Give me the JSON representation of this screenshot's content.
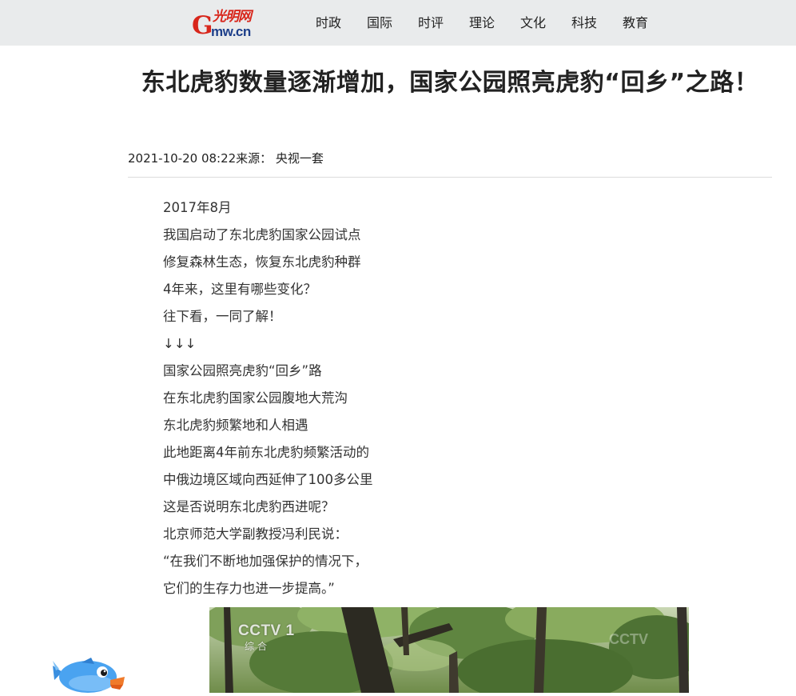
{
  "header": {
    "logo_cn": "光明网",
    "logo_g": "G",
    "logo_domain": "mw.cn",
    "nav": [
      "时政",
      "国际",
      "时评",
      "理论",
      "文化",
      "科技",
      "教育"
    ]
  },
  "article": {
    "title": "东北虎豹数量逐渐增加，国家公园照亮虎豹“回乡”之路！",
    "meta": "2021-10-20 08:22来源： 央视一套",
    "paragraphs": [
      "2017年8月",
      "我国启动了东北虎豹国家公园试点",
      "修复森林生态，恢复东北虎豹种群",
      "4年来，这里有哪些变化？",
      "往下看，一同了解！",
      "↓↓↓",
      "国家公园照亮虎豹“回乡”路",
      "在东北虎豹国家公园腹地大荒沟",
      "东北虎豹频繁地和人相遇",
      "此地距离4年前东北虎豹频繁活动的",
      "中俄边境区域向西延伸了100多公里",
      "这是否说明东北虎豹西进呢？",
      "北京师范大学副教授冯利民说：",
      "“在我们不断地加强保护的情况下，",
      "它们的生存力也进一步提高。”"
    ],
    "video": {
      "badge": "CCTV 1",
      "channel": "综合",
      "watermark": "CCTV"
    }
  },
  "colors": {
    "topbar_bg": "#e9ebec",
    "logo_red": "#d8261b",
    "logo_blue": "#1d3f8a",
    "text": "#333333"
  },
  "icons": {
    "mascot": "blue-fish-mascot-icon"
  }
}
